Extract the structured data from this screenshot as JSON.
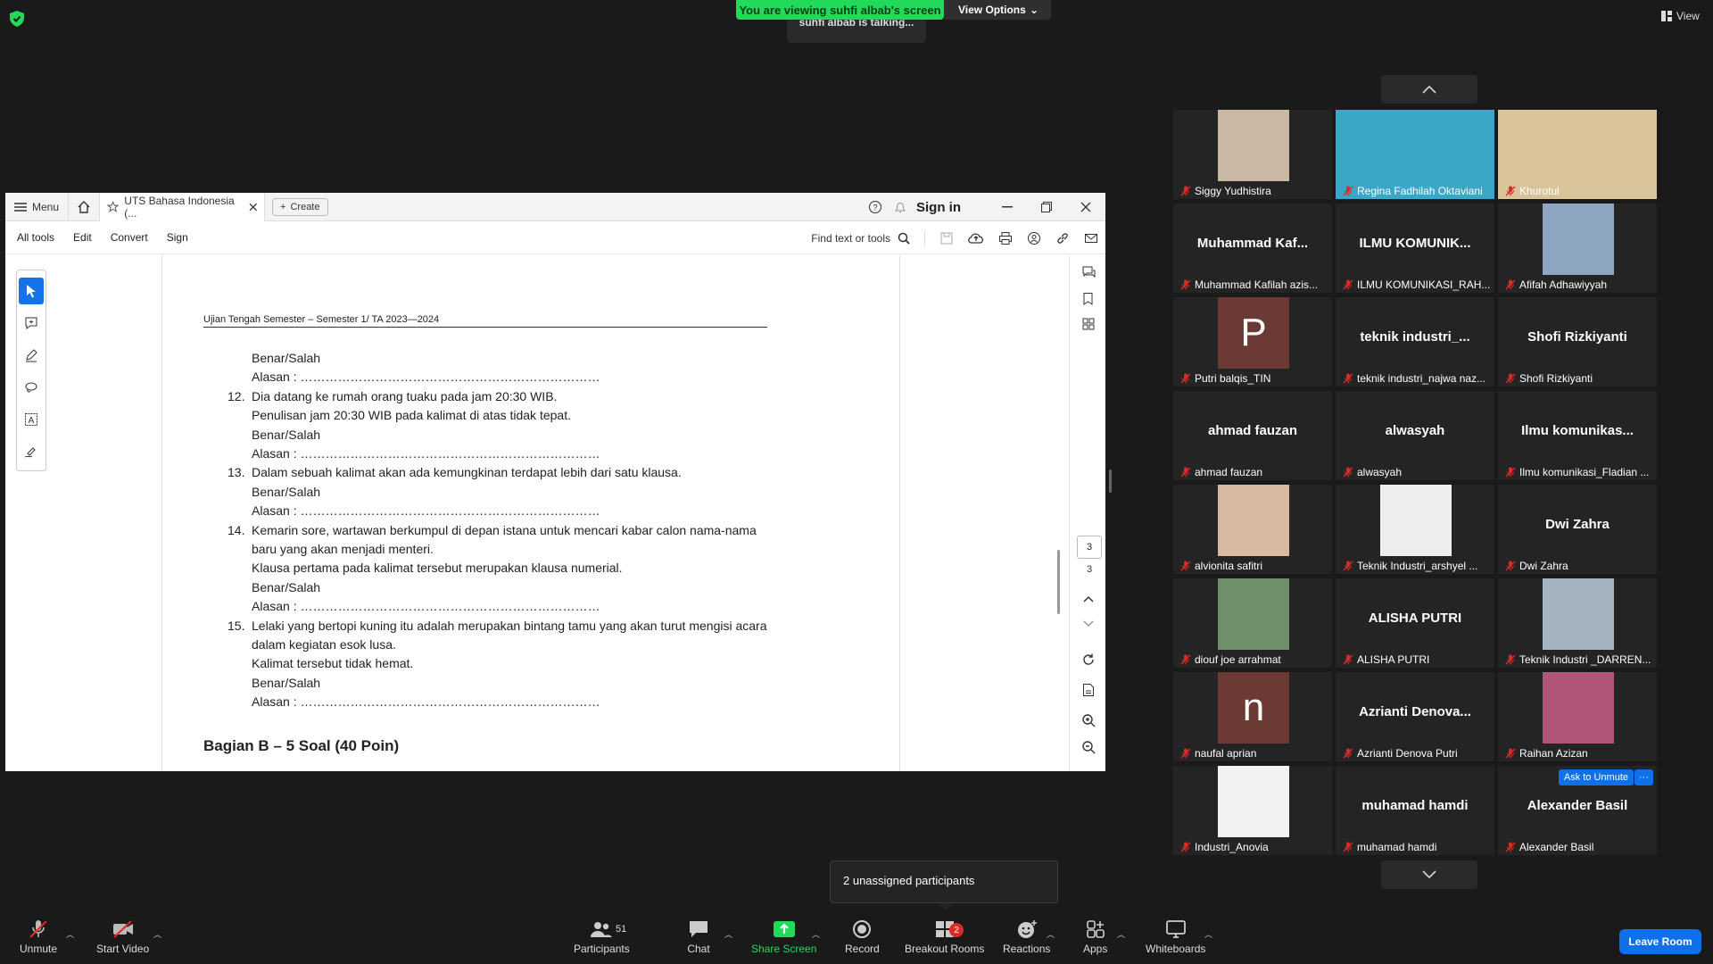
{
  "banner": {
    "viewing": "You are viewing suhfi albab's screen",
    "view_options": "View Options",
    "talking": "suhfi albab is talking...",
    "view": "View"
  },
  "acrobat": {
    "menu": "Menu",
    "tab_title": "UTS Bahasa Indonesia (...",
    "create": "Create",
    "sign_in": "Sign in",
    "menu_items": [
      "All tools",
      "Edit",
      "Convert",
      "Sign"
    ],
    "find": "Find text or tools",
    "page_current": "3",
    "page_total": "3"
  },
  "document": {
    "header": "Ujian Tengah Semester  – Semester 1/ TA 2023—2024",
    "lines": [
      {
        "text": "Benar/Salah"
      },
      {
        "text": "Alasan : ………………………………………………………………"
      },
      {
        "num": "12.",
        "text": "Dia datang ke rumah orang tuaku pada jam 20:30 WIB."
      },
      {
        "text": "Penulisan jam 20:30 WIB pada kalimat di atas tidak tepat."
      },
      {
        "text": "Benar/Salah"
      },
      {
        "text": "Alasan : ………………………………………………………………"
      },
      {
        "num": "13.",
        "text": "Dalam sebuah kalimat akan ada kemungkinan terdapat lebih dari satu klausa."
      },
      {
        "text": "Benar/Salah"
      },
      {
        "text": "Alasan : ………………………………………………………………"
      },
      {
        "num": "14.",
        "text": "Kemarin sore, wartawan berkumpul di depan istana untuk mencari kabar calon nama-nama"
      },
      {
        "text": "baru yang akan menjadi menteri."
      },
      {
        "text": "Klausa pertama pada kalimat tersebut merupakan klausa numerial."
      },
      {
        "text": "Benar/Salah"
      },
      {
        "text": "Alasan : ………………………………………………………………"
      },
      {
        "num": "15.",
        "text": "Lelaki yang bertopi kuning itu adalah merupakan bintang tamu yang akan turut mengisi acara"
      },
      {
        "text": "dalam kegiatan esok lusa."
      },
      {
        "text": "Kalimat tersebut tidak hemat."
      },
      {
        "text": "Benar/Salah"
      },
      {
        "text": "Alasan : ………………………………………………………………"
      }
    ],
    "section": "Bagian B – 5 Soal (40 Poin)"
  },
  "gallery": [
    {
      "name": "Siggy Yudhistira",
      "type": "photo",
      "color": "#c9b8a6"
    },
    {
      "name": "Regina Fadhilah Oktaviani",
      "type": "wide",
      "color": "#3aa7c9"
    },
    {
      "name": "Khurotul",
      "type": "wide",
      "color": "#d9c49a"
    },
    {
      "name": "Muhammad Kafilah azis...",
      "big": "Muhammad  Kaf...",
      "type": "text"
    },
    {
      "name": "ILMU KOMUNIKASI_RAH...",
      "big": "ILMU  KOMUNIK...",
      "type": "text"
    },
    {
      "name": "Afifah Adhawiyyah",
      "type": "photo",
      "color": "#8ea6c2"
    },
    {
      "name": "Putri balqis_TIN",
      "letter": "P",
      "type": "letter",
      "color": "#6b3a34"
    },
    {
      "name": "teknik industri_najwa naz...",
      "big": "teknik  industri_...",
      "type": "text"
    },
    {
      "name": "Shofi Rizkiyanti",
      "big": "Shofi Rizkiyanti",
      "type": "text"
    },
    {
      "name": "ahmad fauzan",
      "big": "ahmad fauzan",
      "type": "text"
    },
    {
      "name": "alwasyah",
      "big": "alwasyah",
      "type": "text"
    },
    {
      "name": "Ilmu komunikasi_Fladian ...",
      "big": "Ilmu  komunikas...",
      "type": "text"
    },
    {
      "name": "alvionita safitri",
      "type": "photo",
      "color": "#d8b9a2"
    },
    {
      "name": "Teknik Industri_arshyel ...",
      "type": "photo",
      "color": "#eeeeee"
    },
    {
      "name": "Dwi Zahra",
      "big": "Dwi Zahra",
      "type": "text"
    },
    {
      "name": "diouf joe arrahmat",
      "type": "photo",
      "color": "#6e8f6a"
    },
    {
      "name": "ALISHA PUTRI",
      "big": "ALISHA PUTRI",
      "type": "text"
    },
    {
      "name": "Teknik Industri _DARREN...",
      "type": "photo",
      "color": "#a3b3c0"
    },
    {
      "name": "naufal aprian",
      "letter": "n",
      "type": "letter",
      "color": "#6b3a34"
    },
    {
      "name": "Azrianti Denova Putri",
      "big": "Azrianti  Denova...",
      "type": "text"
    },
    {
      "name": "Raihan Azizan",
      "type": "photo",
      "color": "#b2557a"
    },
    {
      "name": "Industri_Anovia",
      "type": "photo",
      "color": "#f2f2f2"
    },
    {
      "name": "muhamad hamdi",
      "big": "muhamad hamdi",
      "type": "text"
    },
    {
      "name": "Alexander Basil",
      "big": "Alexander Basil",
      "type": "text",
      "ask": "Ask to Unmute",
      "more": "···"
    }
  ],
  "toast": "2 unassigned participants",
  "toolbar": {
    "unmute": "Unmute",
    "start_video": "Start Video",
    "participants": "Participants",
    "participants_count": "51",
    "chat": "Chat",
    "share_screen": "Share Screen",
    "record": "Record",
    "breakout": "Breakout Rooms",
    "breakout_badge": "2",
    "reactions": "Reactions",
    "apps": "Apps",
    "whiteboards": "Whiteboards",
    "leave": "Leave Room"
  },
  "colors": {
    "accent": "#0e71eb",
    "share_green": "#23d959",
    "mute_red": "#e02828"
  }
}
